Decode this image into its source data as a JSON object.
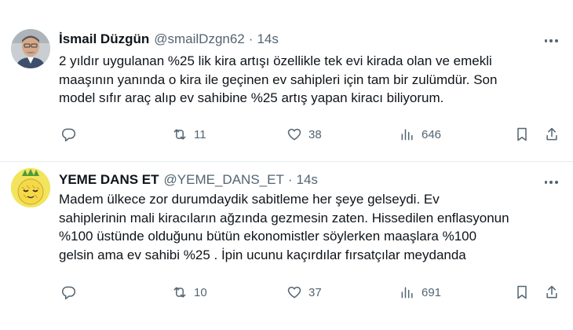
{
  "tweets": [
    {
      "name": "İsmail Düzgün",
      "handle": "@smailDzgn62",
      "separator": "·",
      "time": "14s",
      "text": "2 yıldır uygulanan %25 lik kira artışı özellikle tek evi kirada olan ve emekli\nmaaşının yanında o kira ile geçinen ev sahipleri için tam bir zulümdür. Son\nmodel sıfır araç alıp ev sahibine %25 artış yapan kiracı biliyorum.",
      "retweets": "11",
      "likes": "38",
      "views": "646"
    },
    {
      "name": "YEME DANS ET",
      "handle": "@YEME_DANS_ET",
      "separator": "·",
      "time": "14s",
      "text": "Madem ülkece zor durumdaydik sabitleme her şeye gelseydi. Ev\nsahiplerinin mali kiracıların ağzında gezmesin zaten. Hissedilen enflasyonun\n%100 üstünde olduğunu bütün ekonomistler söylerken maaşlara %100\ngelsin ama ev sahibi %25 . İpin ucunu kaçırdılar fırsatçılar meydanda",
      "retweets": "10",
      "likes": "37",
      "views": "691"
    }
  ],
  "icons": {
    "reply": "reply-icon",
    "retweet": "retweet-icon",
    "like": "like-icon",
    "views": "views-icon",
    "bookmark": "bookmark-icon",
    "share": "share-icon",
    "more": "more-icon"
  },
  "colors": {
    "text": "#0f1419",
    "secondary": "#536471",
    "divider": "#e6ecf0",
    "background": "#ffffff"
  }
}
